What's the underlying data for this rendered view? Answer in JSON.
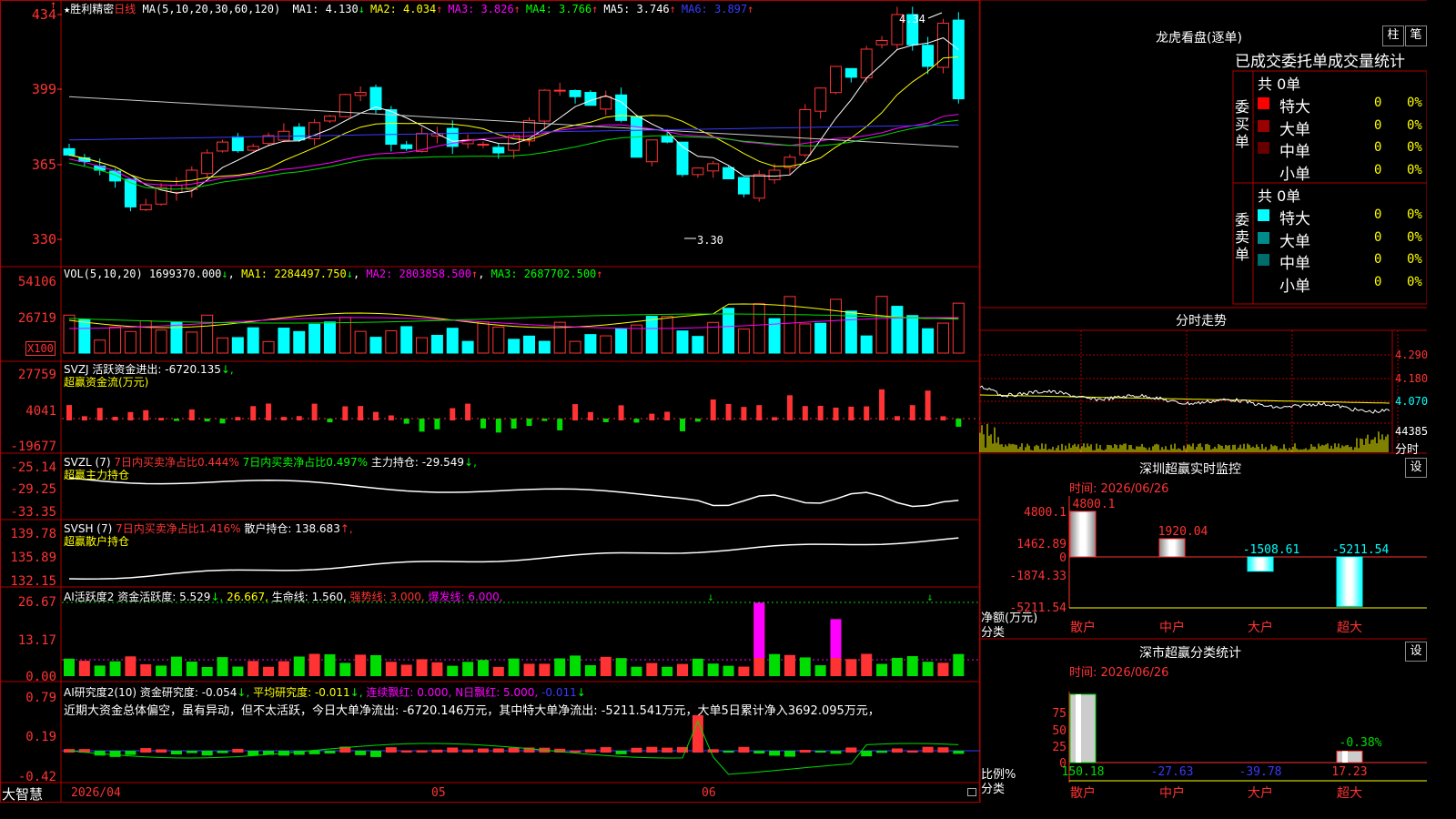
{
  "colors": {
    "up": "#ff3333",
    "down": "#00ffff",
    "vol_down": "#00ffff",
    "green": "#00dd00",
    "yellow": "#ffff00",
    "magenta": "#ff00ff",
    "blue": "#3a3aff",
    "white": "#ffffff",
    "grid": "#b00000"
  },
  "main": {
    "star": "★",
    "stock_name": "胜利精密",
    "period": "日线",
    "ma_header": "MA(5,10,20,30,60,120)",
    "ma_items": [
      {
        "label": "MA1:",
        "value": "4.130",
        "dir": "↓",
        "color": "#ffffff"
      },
      {
        "label": "MA2:",
        "value": "4.034",
        "dir": "↑",
        "color": "#ffff00"
      },
      {
        "label": "MA3:",
        "value": "3.826",
        "dir": "↑",
        "color": "#ff00ff"
      },
      {
        "label": "MA4:",
        "value": "3.766",
        "dir": "↑",
        "color": "#00ff00"
      },
      {
        "label": "MA5:",
        "value": "3.746",
        "dir": "↑",
        "color": "#ffffff"
      },
      {
        "label": "MA6:",
        "value": "3.897",
        "dir": "↑",
        "color": "#3a3aff"
      }
    ],
    "y_ticks": [
      "434",
      "399",
      "365",
      "330"
    ],
    "high_label": "4.34",
    "low_label": "3.30"
  },
  "vol": {
    "header": "VOL(5,10,20)",
    "value": "1699370.000",
    "value_dir": "↓",
    "ma1": "MA1: 2284497.750",
    "ma1_dir": "↓",
    "ma2": "MA2: 2803858.500",
    "ma2_dir": "↑",
    "ma3": "MA3: 2687702.500",
    "ma3_dir": "↑",
    "y_ticks": [
      "54106",
      "26719"
    ],
    "unit": "X100"
  },
  "svzj": {
    "header": "SVZJ  活跃资金进出: -6720.135",
    "header_dir": "↓,",
    "subtitle": "超赢资金流(万元)",
    "y_ticks": [
      "27759",
      "4041",
      "-19677"
    ]
  },
  "svzl": {
    "name": "SVZL (7)",
    "t1": "7日内买卖净占比0.444%",
    "t2": "7日内买卖净占比0.497%",
    "t3": "主力持仓: -29.549",
    "t3_dir": "↓,",
    "subtitle": "超赢主力持仓",
    "y_ticks": [
      "-25.14",
      "-29.25",
      "-33.35"
    ]
  },
  "svsh": {
    "name": "SVSH (7)",
    "t1": "7日内买卖净占比1.416%",
    "t2": "散户持仓: 138.683",
    "t2_dir": "↑,",
    "subtitle": "超赢散户持仓",
    "y_ticks": [
      "139.78",
      "135.89",
      "132.15"
    ]
  },
  "ai1": {
    "name": "AI活跃度2",
    "t1": "资金活跃度: 5.529",
    "t1_dir": "↓,",
    "t2": "26.667,",
    "t3": "生命线: 1.560,",
    "t4": "强势线: 3.000,",
    "t5": "爆发线: 6.000,",
    "y_ticks": [
      "26.67",
      "13.17",
      "0.00"
    ]
  },
  "ai2": {
    "name": "AI研究度2(10)",
    "t1": "资金研究度: -0.054",
    "t1_dir": "↓,",
    "t2": "平均研究度: -0.011",
    "t2_dir": "↓,",
    "t3": "连续飘红: 0.000,",
    "t4": "N日飘红: 5.000,",
    "t5": "-0.011",
    "t5_dir": "↓",
    "comment": "近期大资金总体偏空，虽有异动，但不太活跃，今日大单净流出: -6720.146万元，其中特大单净流出: -5211.541万元，大单5日累计净入3692.095万元，",
    "y_ticks": [
      "0.79",
      "0.19",
      "-0.42"
    ]
  },
  "timeline": {
    "app_name": "大智慧",
    "labels": [
      "2026/04",
      "05",
      "06"
    ]
  },
  "dragon": {
    "title": "龙虎看盘(逐单)",
    "btn1": "柱",
    "btn2": "笔",
    "tabs": "已成交委托单成交量统计",
    "buy_total": "共 0单",
    "buy_label": "委买单",
    "sell_total": "共 0单",
    "sell_label": "委卖单",
    "buy_rows": [
      {
        "name": "特大",
        "count": "0",
        "pct": "0%",
        "color": "#ff0000"
      },
      {
        "name": "大单",
        "count": "0",
        "pct": "0%",
        "color": "#990000"
      },
      {
        "name": "中单",
        "count": "0",
        "pct": "0%",
        "color": "#660000"
      },
      {
        "name": "小单",
        "count": "0",
        "pct": "0%",
        "color": ""
      }
    ],
    "sell_rows": [
      {
        "name": "特大",
        "count": "0",
        "pct": "0%",
        "color": "#00ffff"
      },
      {
        "name": "大单",
        "count": "0",
        "pct": "0%",
        "color": "#008b8b"
      },
      {
        "name": "中单",
        "count": "0",
        "pct": "0%",
        "color": "#006b6b"
      },
      {
        "name": "小单",
        "count": "0",
        "pct": "0%",
        "color": ""
      }
    ]
  },
  "intraday": {
    "title": "分时走势",
    "y_labels": [
      "4.290",
      "4.180",
      "4.070"
    ],
    "vol_label": "44385",
    "vol_unit": "分时"
  },
  "monitor": {
    "title": "深圳超赢实时监控",
    "set": "设",
    "time": "时间: 2026/06/26",
    "y_ticks": [
      "4800.1",
      "1462.89",
      "0",
      "-1874.33",
      "-5211.54"
    ],
    "unit": "净额(万元)",
    "cat_label": "分类",
    "categories": [
      "散户",
      "中户",
      "大户",
      "超大"
    ],
    "values": [
      4800.1,
      1920.04,
      -1508.61,
      -5211.54
    ],
    "value_labels": [
      "4800.1",
      "1920.04",
      "-1508.61",
      "-5211.54"
    ]
  },
  "stats": {
    "title": "深市超赢分类统计",
    "set": "设",
    "time": "时间: 2026/06/26",
    "y_ticks": [
      "75",
      "50",
      "25",
      "0"
    ],
    "unit": "比例%",
    "cat_label": "分类",
    "categories": [
      "散户",
      "中户",
      "大户",
      "超大"
    ],
    "values": [
      150.18,
      -27.63,
      -39.78,
      17.23
    ],
    "value_labels": [
      "150.18",
      "-27.63",
      "-39.78",
      "17.23"
    ],
    "extra_label": "-0.38%"
  }
}
